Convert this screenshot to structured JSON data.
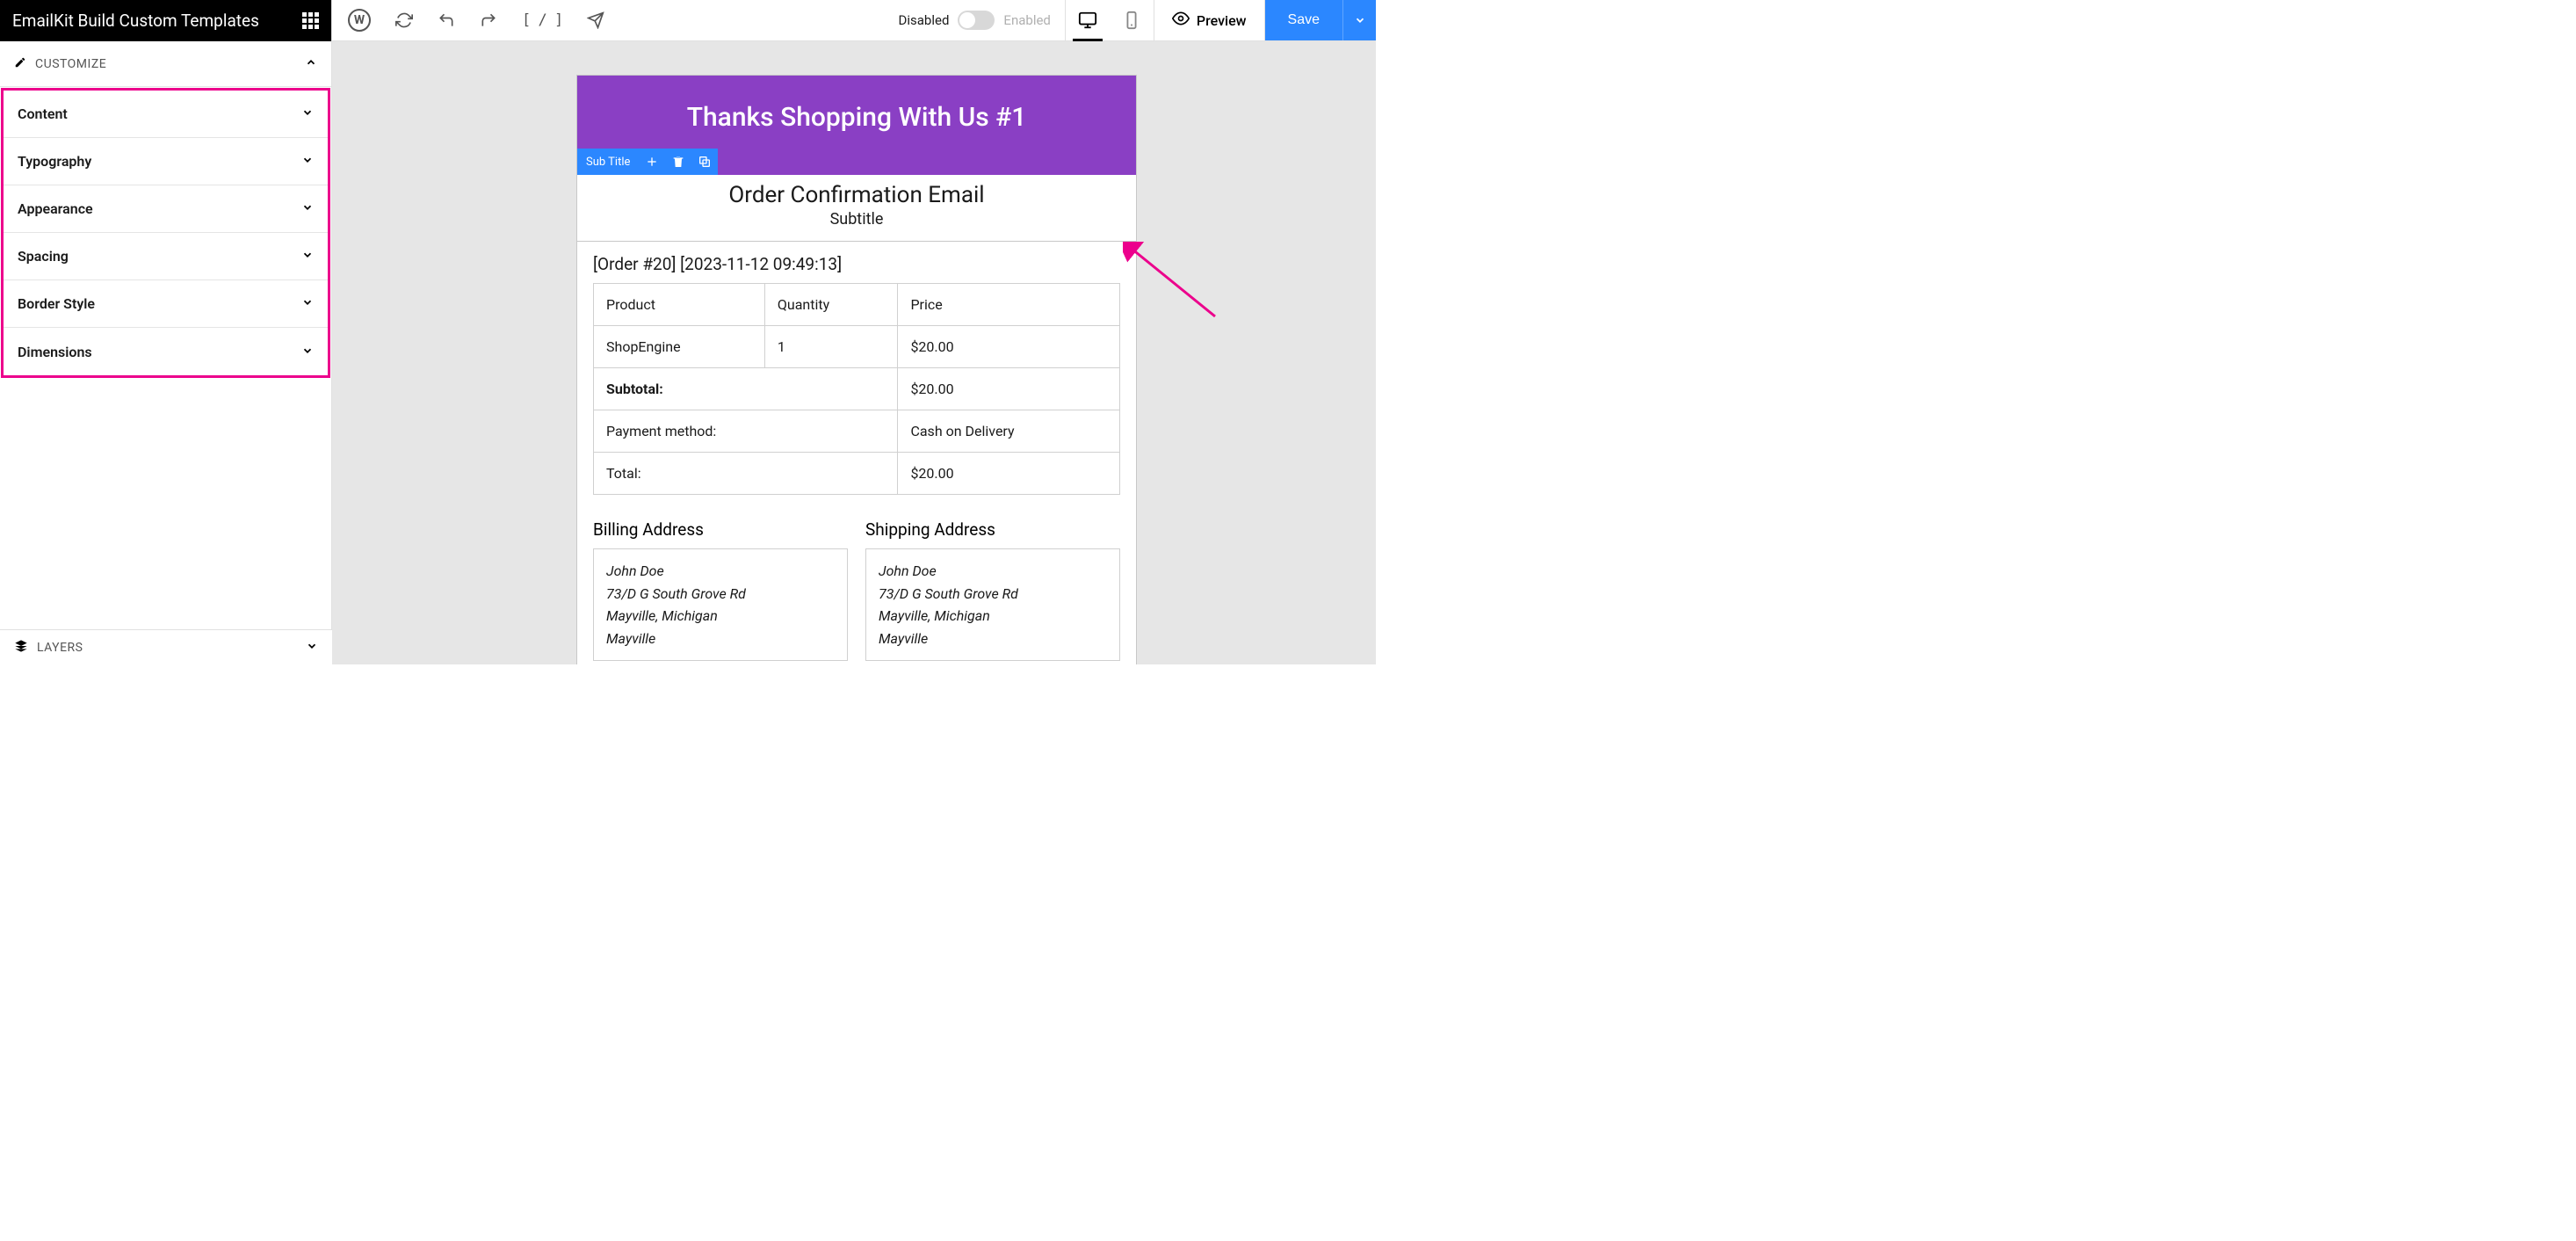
{
  "sidebar": {
    "title": "EmailKit Build Custom Templates",
    "customize_label": "CUSTOMIZE",
    "panels": [
      "Content",
      "Typography",
      "Appearance",
      "Spacing",
      "Border Style",
      "Dimensions"
    ],
    "layers_label": "LAYERS"
  },
  "topbar": {
    "shortcode_text": "[ / ]",
    "toggle": {
      "disabled": "Disabled",
      "enabled": "Enabled"
    },
    "preview": "Preview",
    "save": "Save"
  },
  "email": {
    "header_title": "Thanks Shopping With Us #1",
    "toolbar_label": "Sub Title",
    "title": "Order Confirmation Email",
    "subtitle": "Subtitle",
    "order_meta": "[Order #20] [2023-11-12 09:49:13]",
    "table": {
      "head": [
        "Product",
        "Quantity",
        "Price"
      ],
      "row": [
        "ShopEngine",
        "1",
        "$20.00"
      ],
      "subtotal_label": "Subtotal:",
      "subtotal_value": "$20.00",
      "payment_label": "Payment method:",
      "payment_value": "Cash on Delivery",
      "total_label": "Total:",
      "total_value": "$20.00"
    },
    "billing": {
      "title": "Billing Address",
      "lines": [
        "John Doe",
        "73/D G South Grove Rd",
        "Mayville, Michigan",
        "Mayville"
      ]
    },
    "shipping": {
      "title": "Shipping Address",
      "lines": [
        "John Doe",
        "73/D G South Grove Rd",
        "Mayville, Michigan",
        "Mayville"
      ]
    }
  }
}
